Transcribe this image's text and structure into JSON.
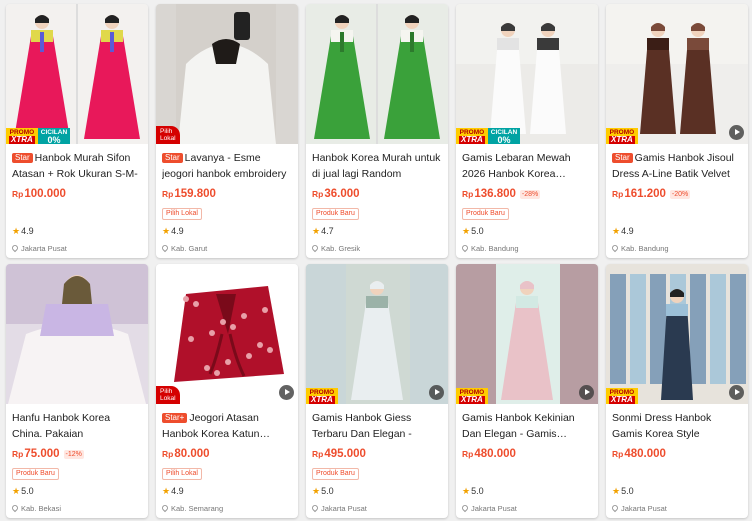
{
  "products": [
    {
      "title": "Hanbok Murah Sifon Atasan + Rok Ukuran S-M-L",
      "tag": "Star",
      "price_prefix": "Rp",
      "price": "100.000",
      "discount": "",
      "label": "",
      "rating": "4.9",
      "location": "Jakarta Pusat",
      "badge": "promo-cicilan",
      "video": false,
      "thumb": {
        "bg": "#f3f1ef",
        "a": "#e8185a",
        "b": "#e0d84a",
        "c": "#5b5bd6",
        "kind": "hanbok-pair"
      }
    },
    {
      "title": "Lavanya - Esme jeogori hanbok embroidery flower…",
      "tag": "Star",
      "price_prefix": "Rp",
      "price": "159.800",
      "discount": "",
      "label": "Pilih Lokal",
      "rating": "4.9",
      "location": "Kab. Garut",
      "badge": "lokal",
      "video": false,
      "thumb": {
        "bg": "#d9d6d2",
        "a": "#f4f4f2",
        "b": "#222222",
        "c": "#cfcac4",
        "kind": "selfie"
      }
    },
    {
      "title": "Hanbok Korea Murah untuk di jual lagi Random",
      "tag": "",
      "price_prefix": "Rp",
      "price": "36.000",
      "discount": "",
      "label": "Produk Baru",
      "rating": "4.7",
      "location": "Kab. Gresik",
      "badge": "",
      "video": false,
      "thumb": {
        "bg": "#e8ece6",
        "a": "#3aa13a",
        "b": "#f5f5f0",
        "c": "#2d7a2d",
        "kind": "hanbok-pair"
      }
    },
    {
      "title": "Gamis Lebaran Mewah 2026 Hanbok Korea…",
      "tag": "",
      "price_prefix": "Rp",
      "price": "136.800",
      "discount": "-28%",
      "label": "Produk Baru",
      "rating": "5.0",
      "location": "Kab. Bandung",
      "badge": "promo-cicilan",
      "video": false,
      "thumb": {
        "bg": "#ecebe8",
        "a": "#fbfbfb",
        "b": "#e3e3e3",
        "c": "#3a3a3a",
        "kind": "gamis-pair"
      }
    },
    {
      "title": "Gamis Hanbok Jisoul Dress A-Line Batik Velvet",
      "tag": "Star",
      "price_prefix": "Rp",
      "price": "161.200",
      "discount": "-20%",
      "label": "",
      "rating": "4.9",
      "location": "Kab. Bandung",
      "badge": "promo",
      "video": true,
      "thumb": {
        "bg": "#efeeec",
        "a": "#5a3024",
        "b": "#3b1e16",
        "c": "#7a4a3a",
        "kind": "gamis-pair"
      }
    },
    {
      "title": "Hanfu Hanbok Korea China. Pakaian tradisional…",
      "tag": "",
      "price_prefix": "Rp",
      "price": "75.000",
      "discount": "-12%",
      "label": "Produk Baru",
      "rating": "5.0",
      "location": "Kab. Bekasi",
      "badge": "",
      "video": false,
      "thumb": {
        "bg": "#e3dce6",
        "a": "#c9b6e4",
        "b": "#f7f3f4",
        "c": "#6a5a3a",
        "kind": "hanbok-single"
      }
    },
    {
      "title": "Jeogori Atasan Hanbok Korea Katun…",
      "tag": "Star+",
      "price_prefix": "Rp",
      "price": "80.000",
      "discount": "",
      "label": "Pilih Lokal",
      "rating": "4.9",
      "location": "Kab. Semarang",
      "badge": "lokal",
      "video": true,
      "thumb": {
        "bg": "#ffffff",
        "a": "#b0102a",
        "b": "#e8a0a8",
        "c": "#7a0a1a",
        "kind": "flatlay"
      }
    },
    {
      "title": "Gamis Hanbok Giess Terbaru Dan Elegan - Gam…",
      "tag": "",
      "price_prefix": "Rp",
      "price": "495.000",
      "discount": "",
      "label": "Produk Baru",
      "rating": "5.0",
      "location": "Jakarta Pusat",
      "badge": "promo",
      "video": true,
      "thumb": {
        "bg": "#cfd9d3",
        "a": "#e9eef0",
        "b": "#9bb2a8",
        "c": "#c9d6d8",
        "kind": "gamis-single"
      }
    },
    {
      "title": "Gamis Hanbok Kekinian Dan Elegan - Gamis…",
      "tag": "",
      "price_prefix": "Rp",
      "price": "480.000",
      "discount": "",
      "label": "",
      "rating": "5.0",
      "location": "Jakarta Pusat",
      "badge": "promo",
      "video": true,
      "thumb": {
        "bg": "#dfeee9",
        "a": "#e9c2c8",
        "b": "#d2e9e3",
        "c": "#b79da2",
        "kind": "gamis-single"
      }
    },
    {
      "title": "Sonmi Dress Hanbok Gamis Korea Style Cantik…",
      "tag": "",
      "price_prefix": "Rp",
      "price": "480.000",
      "discount": "",
      "label": "",
      "rating": "5.0",
      "location": "Jakarta Pusat",
      "badge": "promo",
      "video": true,
      "thumb": {
        "bg": "#e7e3dc",
        "a": "#9cc0d8",
        "b": "#6d8fb0",
        "c": "#2a3a50",
        "kind": "store"
      }
    }
  ],
  "badges": {
    "promo_top": "PROMO",
    "promo_bottom": "XTRA",
    "cicilan_top": "CICILAN",
    "cicilan_bottom": "0%",
    "lokal_top": "Pilih",
    "lokal_bottom": "Lokal"
  },
  "colors": {
    "accent": "#ee4d2d",
    "star": "#f2a100",
    "promo_yellow": "#ffcc00",
    "lokal_red": "#d50000",
    "cicilan_teal": "#00a3a3"
  }
}
